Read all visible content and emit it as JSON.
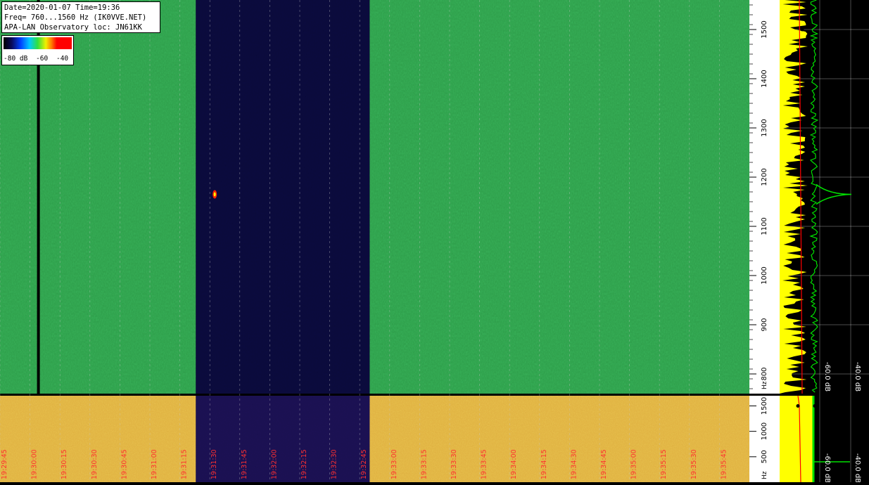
{
  "info": {
    "line1": "Date=2020-01-07 Time=19:36",
    "line2": "Freq= 760...1560 Hz (IK0VVE.NET)",
    "line3": "APA-LAN Observatory loc: JN61KK"
  },
  "color_scale": {
    "labels": [
      "-80 dB",
      "-60",
      "-40"
    ]
  },
  "colors": {
    "band_noise": "#2e9e4a",
    "quiet": "#0a0a3a",
    "lower_band": "#e0b040",
    "lower_quiet": "#1a1050",
    "tick_text": "#ff3030",
    "spectrum_yellow": "#ffff00",
    "spectrum_green": "#00e000",
    "spectrum_red": "#ff0000"
  },
  "chart_data": [
    {
      "type": "heatmap",
      "title": "",
      "ylabel": "Hz",
      "ylim": [
        760,
        1560
      ],
      "y_ticks": [
        "800",
        "900",
        "1000",
        "1100",
        "1200",
        "1300",
        "1400",
        "1500"
      ],
      "y_unit_label": "Hz",
      "regions": [
        {
          "start": "19:29:45",
          "end": "19:31:23",
          "level": "noise"
        },
        {
          "start": "19:31:23",
          "end": "19:32:50",
          "level": "quiet"
        },
        {
          "start": "19:32:50",
          "end": "19:36:00",
          "level": "noise"
        }
      ],
      "features": [
        {
          "type": "carrier-line",
          "time": "19:30:00",
          "note": ""
        },
        {
          "type": "meteor-echo",
          "time": "19:31:30",
          "freq": 1165
        }
      ]
    },
    {
      "type": "heatmap",
      "ylim": [
        0,
        1700
      ],
      "y_ticks": [
        "500",
        "1000",
        "1500"
      ],
      "y_unit_label": "Hz",
      "x_ticks": [
        "19:29:45",
        "19:30:00",
        "19:30:15",
        "19:30:30",
        "19:30:45",
        "19:31:00",
        "19:31:15",
        "19:31:30",
        "19:31:45",
        "19:32:00",
        "19:32:15",
        "19:32:30",
        "19:32:45",
        "19:33:00",
        "19:33:15",
        "19:33:30",
        "19:33:45",
        "19:34:00",
        "19:34:15",
        "19:34:30",
        "19:34:45",
        "19:35:00",
        "19:35:15",
        "19:35:30",
        "19:35:45"
      ]
    },
    {
      "type": "line",
      "series": [],
      "x_ticks": [
        "-60.0 dB",
        "-40.0 dB"
      ],
      "peak": {
        "freq": 1165,
        "level_db": -40
      }
    },
    {
      "type": "line",
      "x_ticks": [
        "-60.0 dB",
        "-40.0 dB"
      ]
    }
  ]
}
